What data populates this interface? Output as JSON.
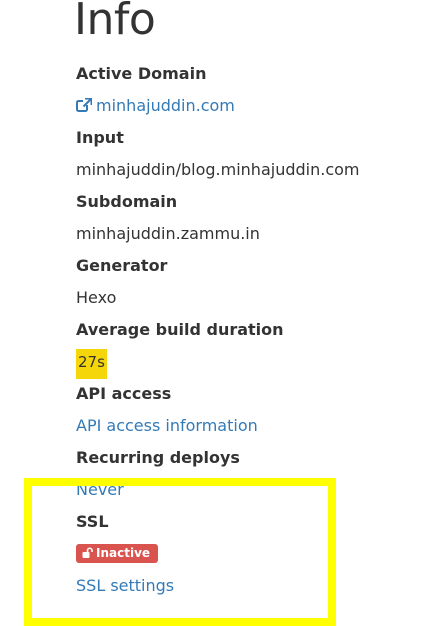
{
  "page": {
    "title": "Info"
  },
  "info": {
    "active_domain": {
      "label": "Active Domain",
      "value": "minhajuddin.com",
      "icon": "external-link-icon"
    },
    "input": {
      "label": "Input",
      "value": "minhajuddin/blog.minhajuddin.com"
    },
    "subdomain": {
      "label": "Subdomain",
      "value": "minhajuddin.zammu.in"
    },
    "generator": {
      "label": "Generator",
      "value": "Hexo"
    },
    "average_build_duration": {
      "label": "Average build duration",
      "value": "27s",
      "badge_color": "#f5d60a"
    },
    "api_access": {
      "label": "API access",
      "link": "API access information"
    },
    "recurring_deploys": {
      "label": "Recurring deploys",
      "value": "Never"
    },
    "ssl": {
      "label": "SSL",
      "status": "Inactive",
      "status_icon": "unlock-icon",
      "status_color": "#d9534f",
      "settings_link": "SSL settings"
    }
  },
  "colors": {
    "link": "#337ab7",
    "highlight": "#ffff00",
    "text": "#333333"
  }
}
